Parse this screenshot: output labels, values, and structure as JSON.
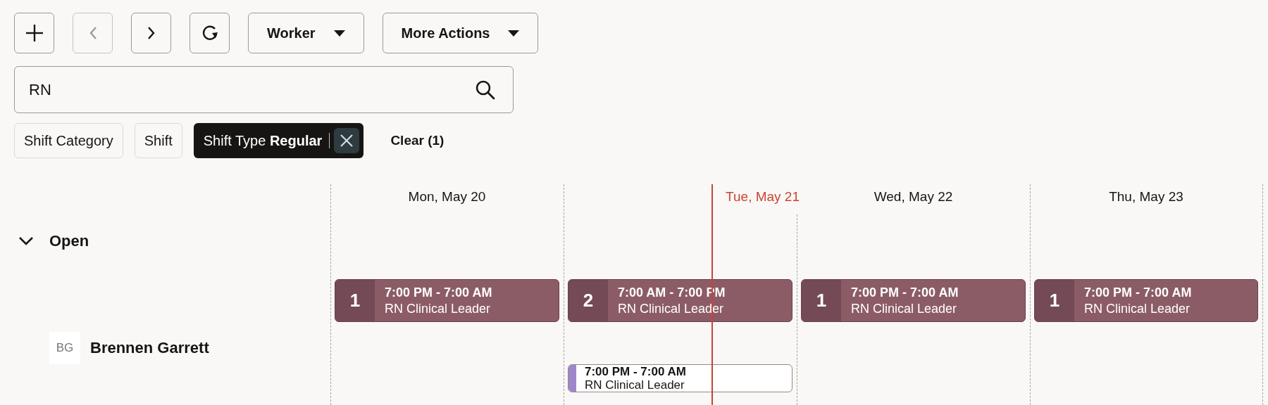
{
  "toolbar": [
    {
      "kind": "add",
      "disabled": false
    },
    {
      "kind": "previous",
      "disabled": true
    },
    {
      "kind": "next",
      "disabled": false
    },
    {
      "kind": "refresh",
      "disabled": false
    },
    {
      "kind": "menu",
      "label": "Worker",
      "disabled": false
    },
    {
      "kind": "menu",
      "label": "More Actions",
      "disabled": false
    }
  ],
  "search": {
    "value": "RN"
  },
  "filters": [
    {
      "label": "Shift Category",
      "selected": false
    },
    {
      "label": "Shift",
      "selected": false
    },
    {
      "label": "Shift Type",
      "value": "Regular",
      "selected": true
    }
  ],
  "clear_filters": "Clear (1)",
  "columns": [
    {
      "label": "Mon, May 20",
      "today": false
    },
    {
      "label": "Tue, May 21",
      "today": true
    },
    {
      "label": "Wed, May 22",
      "today": false
    },
    {
      "label": "Thu, May 23",
      "today": false
    }
  ],
  "rows": [
    {
      "kind": "group",
      "label": "Open",
      "expanded": true,
      "days": [
        {
          "shift": {
            "count": "1",
            "time": "7:00 PM - 7:00 AM",
            "role": "RN Clinical Leader"
          }
        },
        {
          "shift": {
            "count": "2",
            "time": "7:00 AM - 7:00 PM",
            "role": "RN Clinical Leader"
          }
        },
        {
          "shift": {
            "count": "1",
            "time": "7:00 PM - 7:00 AM",
            "role": "RN Clinical Leader"
          }
        },
        {
          "shift": {
            "count": "1",
            "time": "7:00 PM - 7:00 AM",
            "role": "RN Clinical Leader"
          }
        }
      ]
    },
    {
      "kind": "worker",
      "initials": "BG",
      "name": "Brennen Garrett",
      "days": [
        {
          "kind": "free"
        },
        {
          "kind": "shift",
          "shift": {
            "time": "7:00 PM - 7:00 AM",
            "role": "RN Clinical Leader",
            "color": "#9d87c8"
          }
        },
        {
          "kind": "free"
        },
        {
          "kind": "free"
        }
      ]
    }
  ]
}
